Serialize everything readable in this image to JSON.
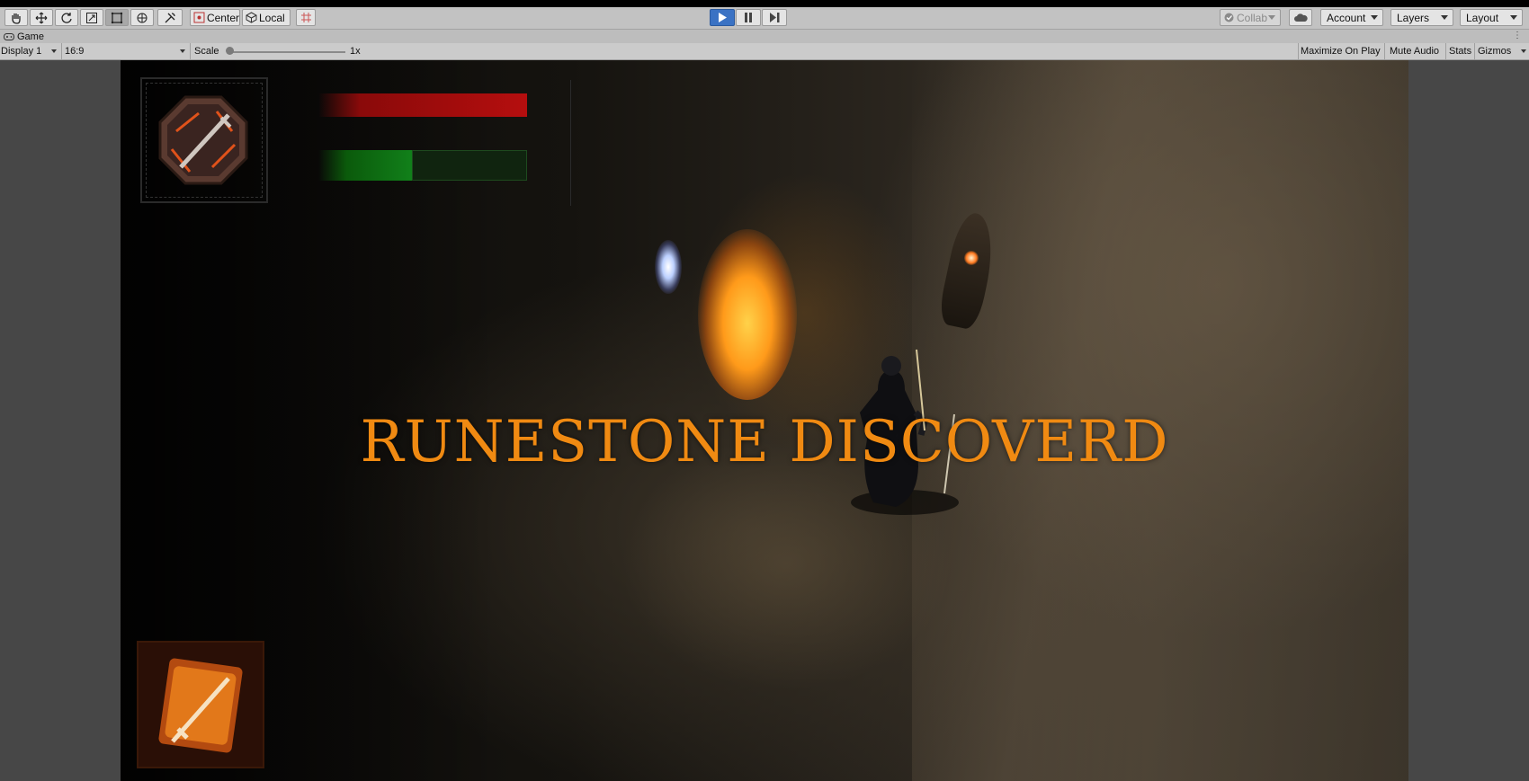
{
  "toolbar": {
    "tools": [
      "hand-icon",
      "move-icon",
      "rotate-icon",
      "scale-icon",
      "rect-icon",
      "transform-icon",
      "custom-tool-icon"
    ],
    "pivot_mode": "Center",
    "pivot_rotation": "Local",
    "collab": "Collab",
    "account": "Account",
    "layers": "Layers",
    "layout": "Layout",
    "play_state": "playing"
  },
  "tab": {
    "title": "Game"
  },
  "game_controls": {
    "display": "Display 1",
    "aspect": "16:9",
    "scale_label": "Scale",
    "scale_value": "1x",
    "maximize_on_play": "Maximize On Play",
    "mute_audio": "Mute Audio",
    "stats": "Stats",
    "gizmos": "Gizmos"
  },
  "game": {
    "banner_text": "RUNESTONE DISCOVERD",
    "health_fraction": 1.0,
    "mana_fraction": 0.45,
    "colors": {
      "banner": "#f08a12",
      "health": "#b50e0e",
      "mana": "#11801a",
      "play_button": "#3a72c4"
    }
  }
}
